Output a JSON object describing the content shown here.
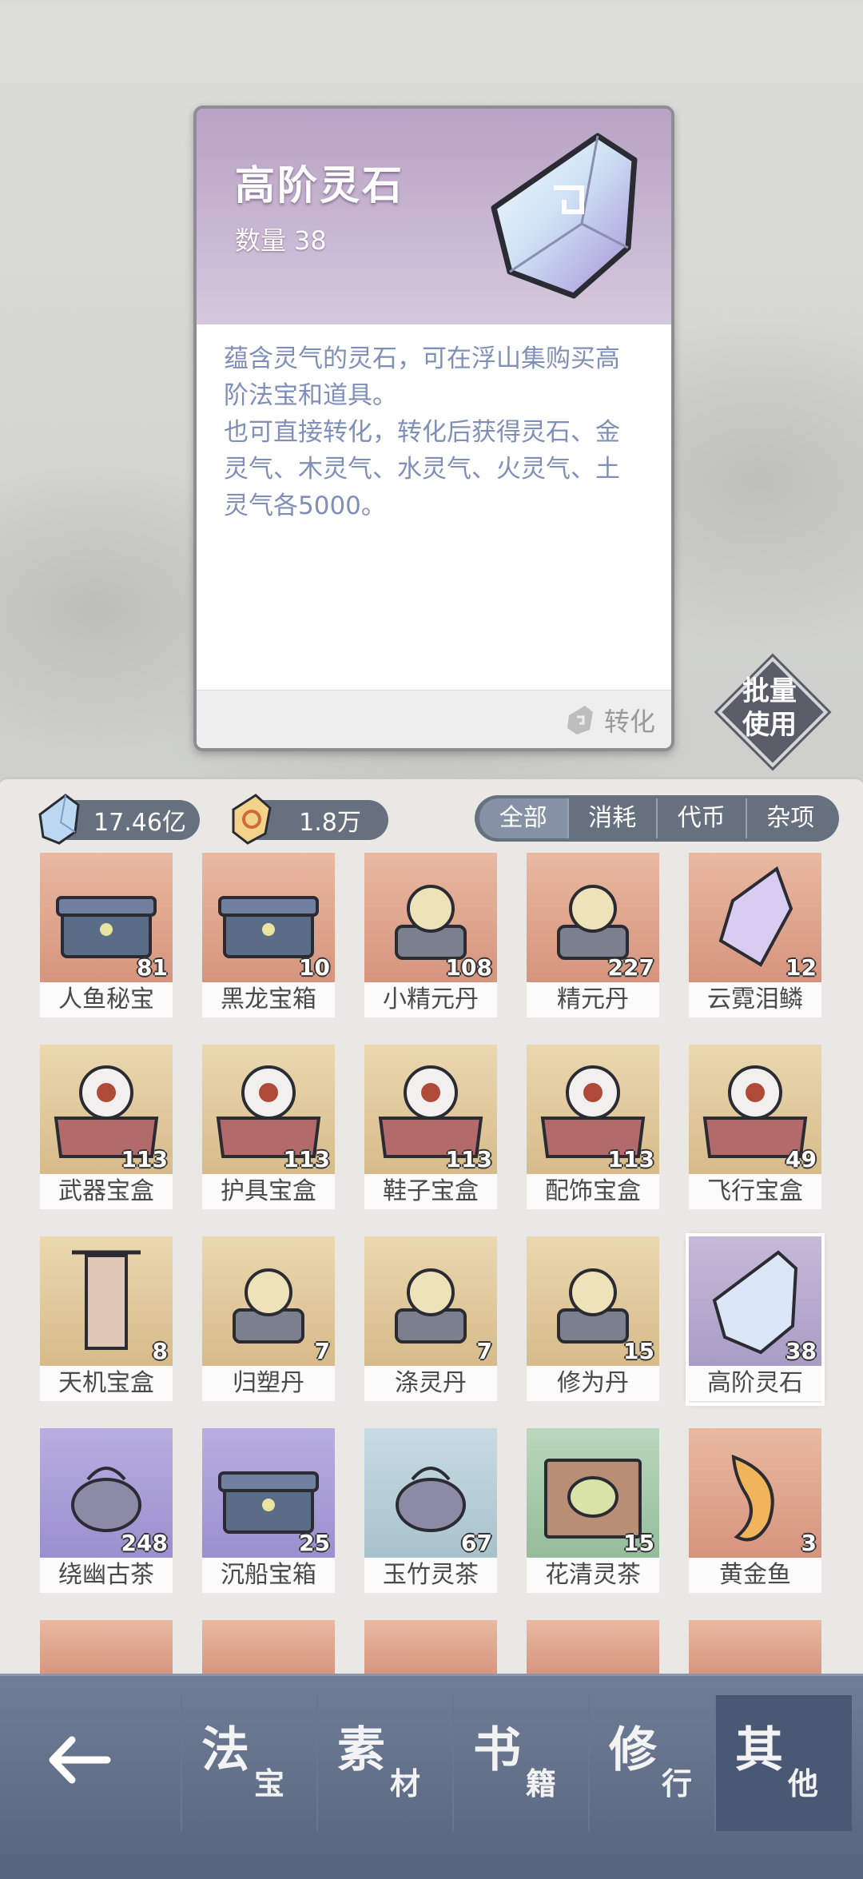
{
  "detail": {
    "title": "高阶灵石",
    "qty_label": "数量",
    "qty_value": "38",
    "description": "蕴含灵气的灵石，可在浮山集购买高阶法宝和道具。\n也可直接转化，转化后获得灵石、金灵气、木灵气、水灵气、火灵气、土灵气各5000。",
    "convert_label": "转化"
  },
  "batch_use_label": "批量\n使用",
  "currency": {
    "stones": "17.46亿",
    "tokens": "1.8万"
  },
  "filter_tabs": [
    {
      "label": "全部",
      "active": true
    },
    {
      "label": "消耗",
      "active": false
    },
    {
      "label": "代币",
      "active": false
    },
    {
      "label": "杂项",
      "active": false
    }
  ],
  "items": [
    {
      "name": "人鱼秘宝",
      "count": "81",
      "bg": "orange",
      "icon": "chest-icon"
    },
    {
      "name": "黑龙宝箱",
      "count": "10",
      "bg": "orange",
      "icon": "chest-icon"
    },
    {
      "name": "小精元丹",
      "count": "108",
      "bg": "orange",
      "icon": "pill-icon"
    },
    {
      "name": "精元丹",
      "count": "227",
      "bg": "orange",
      "icon": "pill-icon"
    },
    {
      "name": "云霓泪鳞",
      "count": "12",
      "bg": "orange",
      "icon": "crystal-icon"
    },
    {
      "name": "武器宝盒",
      "count": "113",
      "bg": "gold",
      "icon": "box-icon"
    },
    {
      "name": "护具宝盒",
      "count": "113",
      "bg": "gold",
      "icon": "box-icon"
    },
    {
      "name": "鞋子宝盒",
      "count": "113",
      "bg": "gold",
      "icon": "box-icon"
    },
    {
      "name": "配饰宝盒",
      "count": "113",
      "bg": "gold",
      "icon": "box-icon"
    },
    {
      "name": "飞行宝盒",
      "count": "49",
      "bg": "gold",
      "icon": "box-icon"
    },
    {
      "name": "天机宝盒",
      "count": "8",
      "bg": "gold",
      "icon": "tablet-icon"
    },
    {
      "name": "归塑丹",
      "count": "7",
      "bg": "gold",
      "icon": "pill-icon"
    },
    {
      "name": "涤灵丹",
      "count": "7",
      "bg": "gold",
      "icon": "pill-icon"
    },
    {
      "name": "修为丹",
      "count": "15",
      "bg": "gold",
      "icon": "pill-icon"
    },
    {
      "name": "高阶灵石",
      "count": "38",
      "bg": "purple",
      "icon": "gem-icon",
      "selected": true
    },
    {
      "name": "绕幽古茶",
      "count": "248",
      "bg": "violet",
      "icon": "teapot-icon"
    },
    {
      "name": "沉船宝箱",
      "count": "25",
      "bg": "violet",
      "icon": "chest-icon"
    },
    {
      "name": "玉竹灵茶",
      "count": "67",
      "bg": "blue",
      "icon": "teapot-icon"
    },
    {
      "name": "花清灵茶",
      "count": "15",
      "bg": "green",
      "icon": "tea-bowl-icon"
    },
    {
      "name": "黄金鱼",
      "count": "3",
      "bg": "orange",
      "icon": "fish-icon"
    }
  ],
  "nav_tabs": [
    {
      "big": "法",
      "small": "宝",
      "active": false
    },
    {
      "big": "素",
      "small": "材",
      "active": false
    },
    {
      "big": "书",
      "small": "籍",
      "active": false
    },
    {
      "big": "修",
      "small": "行",
      "active": false
    },
    {
      "big": "其",
      "small": "他",
      "active": true
    }
  ]
}
